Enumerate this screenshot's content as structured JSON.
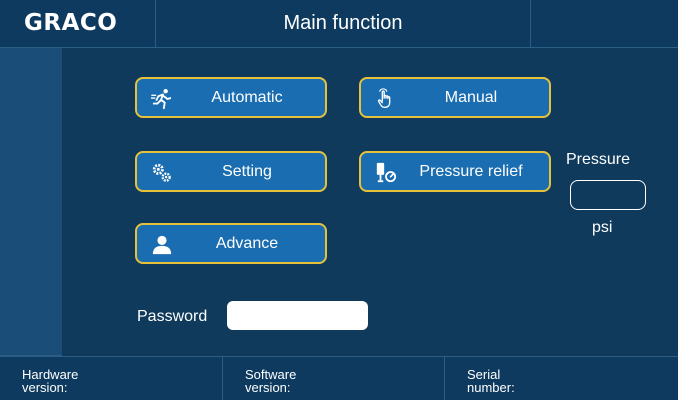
{
  "header": {
    "logo": "GRACO",
    "title": "Main function"
  },
  "buttons": {
    "automatic": {
      "label": "Automatic",
      "icon": "running-person-icon"
    },
    "manual": {
      "label": "Manual",
      "icon": "hand-pointer-icon"
    },
    "setting": {
      "label": "Setting",
      "icon": "gears-icon"
    },
    "pressure_relief": {
      "label": "Pressure relief",
      "icon": "pressure-valve-icon"
    },
    "advance": {
      "label": "Advance",
      "icon": "user-icon"
    }
  },
  "pressure": {
    "label": "Pressure",
    "value": "",
    "unit": "psi"
  },
  "password": {
    "label": "Password",
    "value": ""
  },
  "footer": {
    "hardware_version": "Hardware\nversion:",
    "software_version": "Software\nversion:",
    "serial_number": "Serial\nnumber:"
  },
  "colors": {
    "background": "#0f3a5c",
    "button_fill": "#1a6db0",
    "button_border": "#e6c23b",
    "divider": "#2a5e86"
  }
}
